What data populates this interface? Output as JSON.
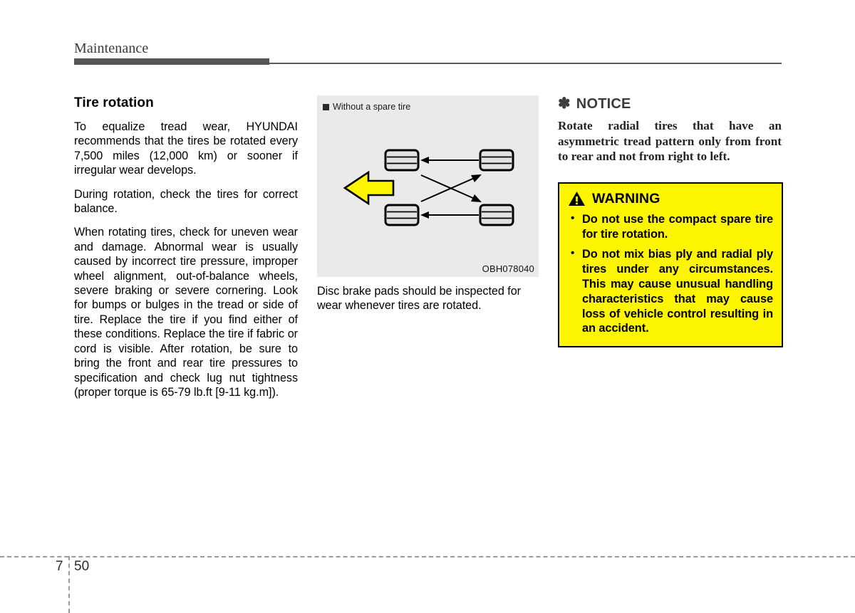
{
  "header": {
    "chapter_title": "Maintenance"
  },
  "left_column": {
    "section_title": "Tire rotation",
    "paragraphs": [
      "To equalize tread wear, HYUNDAI recommends that the tires be rotated every 7,500 miles (12,000 km) or sooner if irregular wear develops.",
      "During rotation, check the tires for correct balance.",
      "When rotating tires, check for uneven wear and damage. Abnormal wear is usually caused by incorrect tire pressure, improper wheel alignment, out-of-balance wheels, severe braking or severe cornering. Look for bumps or bulges in the tread or side of tire. Replace the tire if you find either of these conditions. Replace the tire if fabric or cord is visible. After rotation, be sure to bring the front and rear tire pressures to specification and check lug nut tightness (proper torque is 65-79 lb.ft [9-11 kg.m])."
    ]
  },
  "figure": {
    "label": "Without a spare tire",
    "image_code": "OBH078040",
    "caption": "Disc brake pads should be inspected for wear whenever tires are rotated.",
    "background_color": "#eaeaea",
    "direction_arrow_color": "#fdf500",
    "direction_arrow_name": "direction-of-travel-arrow",
    "wheels": [
      {
        "name": "front-left-wheel",
        "position": "front-left"
      },
      {
        "name": "rear-left-wheel",
        "position": "rear-left"
      },
      {
        "name": "front-right-wheel",
        "position": "front-right"
      },
      {
        "name": "rear-right-wheel",
        "position": "rear-right"
      }
    ],
    "rotation_arrows": [
      {
        "name": "rear-left-to-front-left-arrow",
        "type": "straight"
      },
      {
        "name": "rear-right-to-front-right-arrow",
        "type": "straight"
      },
      {
        "name": "front-left-to-rear-right-arrow",
        "type": "diagonal"
      },
      {
        "name": "rear-left-to-front-right-arrow",
        "type": "diagonal"
      }
    ]
  },
  "notice": {
    "icon": "asterisk-icon",
    "glyph": "✽",
    "heading": "NOTICE",
    "text": "Rotate radial tires that have an asymmetric tread pattern only from front to rear and not from right to left."
  },
  "warning": {
    "icon": "warning-triangle-icon",
    "heading": "WARNING",
    "background_color": "#fdf500",
    "items": [
      "Do not use the compact spare tire for tire rotation.",
      "Do not mix bias ply and radial ply tires under any circumstances. This may cause unusual handling characteristics that may cause loss of vehicle control resulting in an accident."
    ]
  },
  "footer": {
    "chapter_number": "7",
    "page_number": "50"
  }
}
